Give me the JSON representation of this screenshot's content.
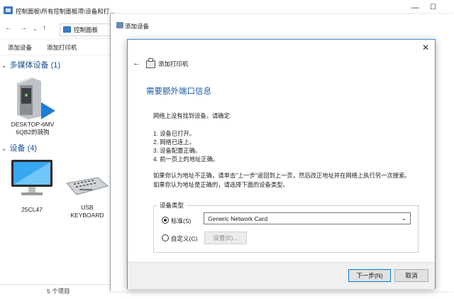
{
  "explorer": {
    "title": "控制面板\\所有控制面板项\\设备和打...",
    "address": "控制面板",
    "commands": [
      "添加设备",
      "添加打印机"
    ],
    "group_multimedia": "多媒体设备 (1)",
    "group_devices": "设备 (4)",
    "multimedia_device": [
      "DESKTOP-6MV",
      "6QB2的骑狗"
    ],
    "devices": [
      "25CL47",
      "USB",
      "KEYBOARD"
    ],
    "status": "5 个项目"
  },
  "add_device_window": {
    "title": "添加设备"
  },
  "dialog": {
    "header": "添加打印机",
    "title": "需要额外端口信息",
    "intro": "网络上没有找到设备。请确定:",
    "steps": [
      "1.  设备已打开。",
      "2.  网络已连上。",
      "3.  设备配置正确。",
      "4.  前一页上的地址正确。"
    ],
    "para1": "如果你认为地址不正确，请单击\"上一步\"返回到上一页，然后改正地址并在网络上执行另一次搜索。",
    "para2": "如果你认为地址是正确的，请选择下面的设备类型。",
    "device_type_label": "设备类型",
    "standard_label": "标准(S)",
    "standard_value": "Generic Network Card",
    "custom_label": "自定义(C)",
    "settings_button": "设置(E)...",
    "next_button": "下一步(N)",
    "cancel_button": "取消"
  }
}
